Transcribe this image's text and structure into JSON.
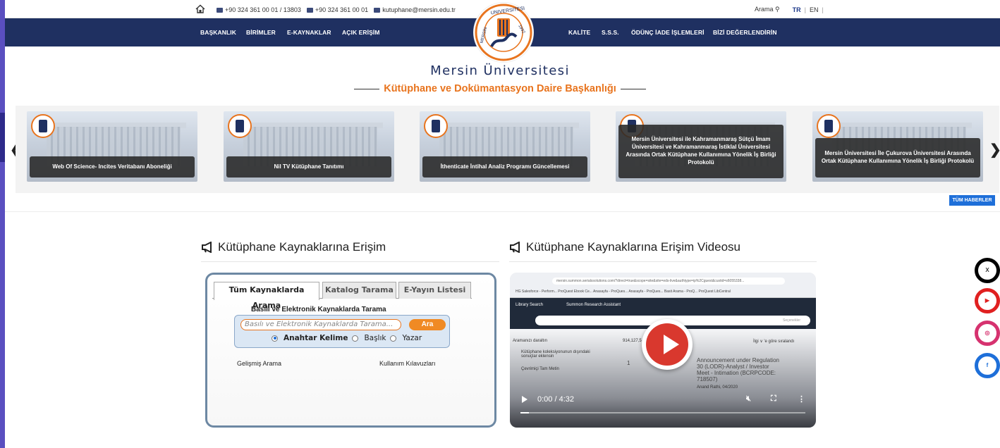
{
  "topbar": {
    "phone1": "+90 324 361 00 01 / 13803",
    "fax": "+90 324 361 00 01",
    "email": "kutuphane@mersin.edu.tr",
    "search_label": "Arama",
    "lang_tr": "TR",
    "lang_en": "EN"
  },
  "nav": {
    "left": [
      "BAŞKANLIK",
      "BİRİMLER",
      "E-KAYNAKLAR",
      "AÇIK ERİŞİM"
    ],
    "right": [
      "KALİTE",
      "S.S.S.",
      "ÖDÜNÇ İADE İŞLEMLERİ",
      "BİZİ DEĞERLENDİRİN"
    ]
  },
  "logo": {
    "top_text": "UNIVERSITESI",
    "left_text": "MERSİN",
    "year": "1992"
  },
  "header": {
    "university": "Mersin Üniversitesi",
    "department": "Kütüphane ve Dokümantasyon Daire Başkanlığı"
  },
  "carousel": {
    "prev": "❮",
    "next": "❯",
    "items": [
      "Web Of Science- Incites Veritabanı Aboneliği",
      "Nil TV Kütüphane Tanıtımı",
      "İthenticate İntihal Analiz Programı Güncellemesi",
      "Mersin Üniversitesi ile Kahramanmaraş Sütçü İmam Üniversitesi ve Kahramanmaraş İstiklal Üniversitesi Arasında Ortak Kütüphane Kullanımına Yönelik İş Birliği Protokolü",
      "Mersin Üniversitesi İle Çukurova Üniversitesi Arasında Ortak Kütüphane Kullanımına Yönelik İş Birliği Protokolü"
    ],
    "all_news": "TÜM HABERLER"
  },
  "access": {
    "title": "Kütüphane Kaynaklarına Erişim",
    "tabs": [
      "Tüm Kaynaklarda Arama",
      "Katalog Tarama",
      "E-Yayın Listesi"
    ],
    "search_heading": "Basılı ve Elektronik Kaynaklarda Tarama",
    "search_placeholder": "Basılı ve Elektronik Kaynaklarda Tarama...",
    "search_button": "Ara",
    "radio_keyword": "Anahtar Kelime",
    "radio_title": "Başlık",
    "radio_author": "Yazar",
    "advanced": "Gelişmiş Arama",
    "guides": "Kullanım Kılavuzları"
  },
  "video": {
    "title": "Kütüphane Kaynaklarına Erişim Videosu",
    "url": "mersin.summon.serialssolutions.com/?direct=true&scope=site&site=eds-live&authtype=ip%2Cguest&custid=s6055338...",
    "bookmarks": "HG   Salesforce - Perform...   ProQuest Ebook Ce...   Anasayfa - ProQues...   Anasayfa - ProQues...   Basit Arama - ProQ...   ProQuest LibCentral",
    "tab_library": "Library Search",
    "tab_assistant": "Summon Research Assistant",
    "search_options": "Seçenekler",
    "refine": "Aramanızı daraltın",
    "count": "914,127,5",
    "sort": "İlgi ∨ 'e göre sıralandı",
    "filter1": "Kütüphane koleksiyonunun dışındaki sonuçlar eklensin",
    "filter2": "Çevrimiçi Tam Metin",
    "result_no": "1",
    "result_title": "Announcement under Regulation 30 (LODR)-Analyst / Investor Meet - Intimation (BCRPCODE: 718507)",
    "result_meta": "Anand Rathi, 04/2020",
    "time": "0:00 / 4:32",
    "progress": 0.03
  },
  "social": [
    "x",
    "youtube",
    "instagram",
    "facebook"
  ],
  "colors": {
    "navy": "#1f3061",
    "orange": "#e8741e",
    "blue": "#1e6fd9"
  }
}
